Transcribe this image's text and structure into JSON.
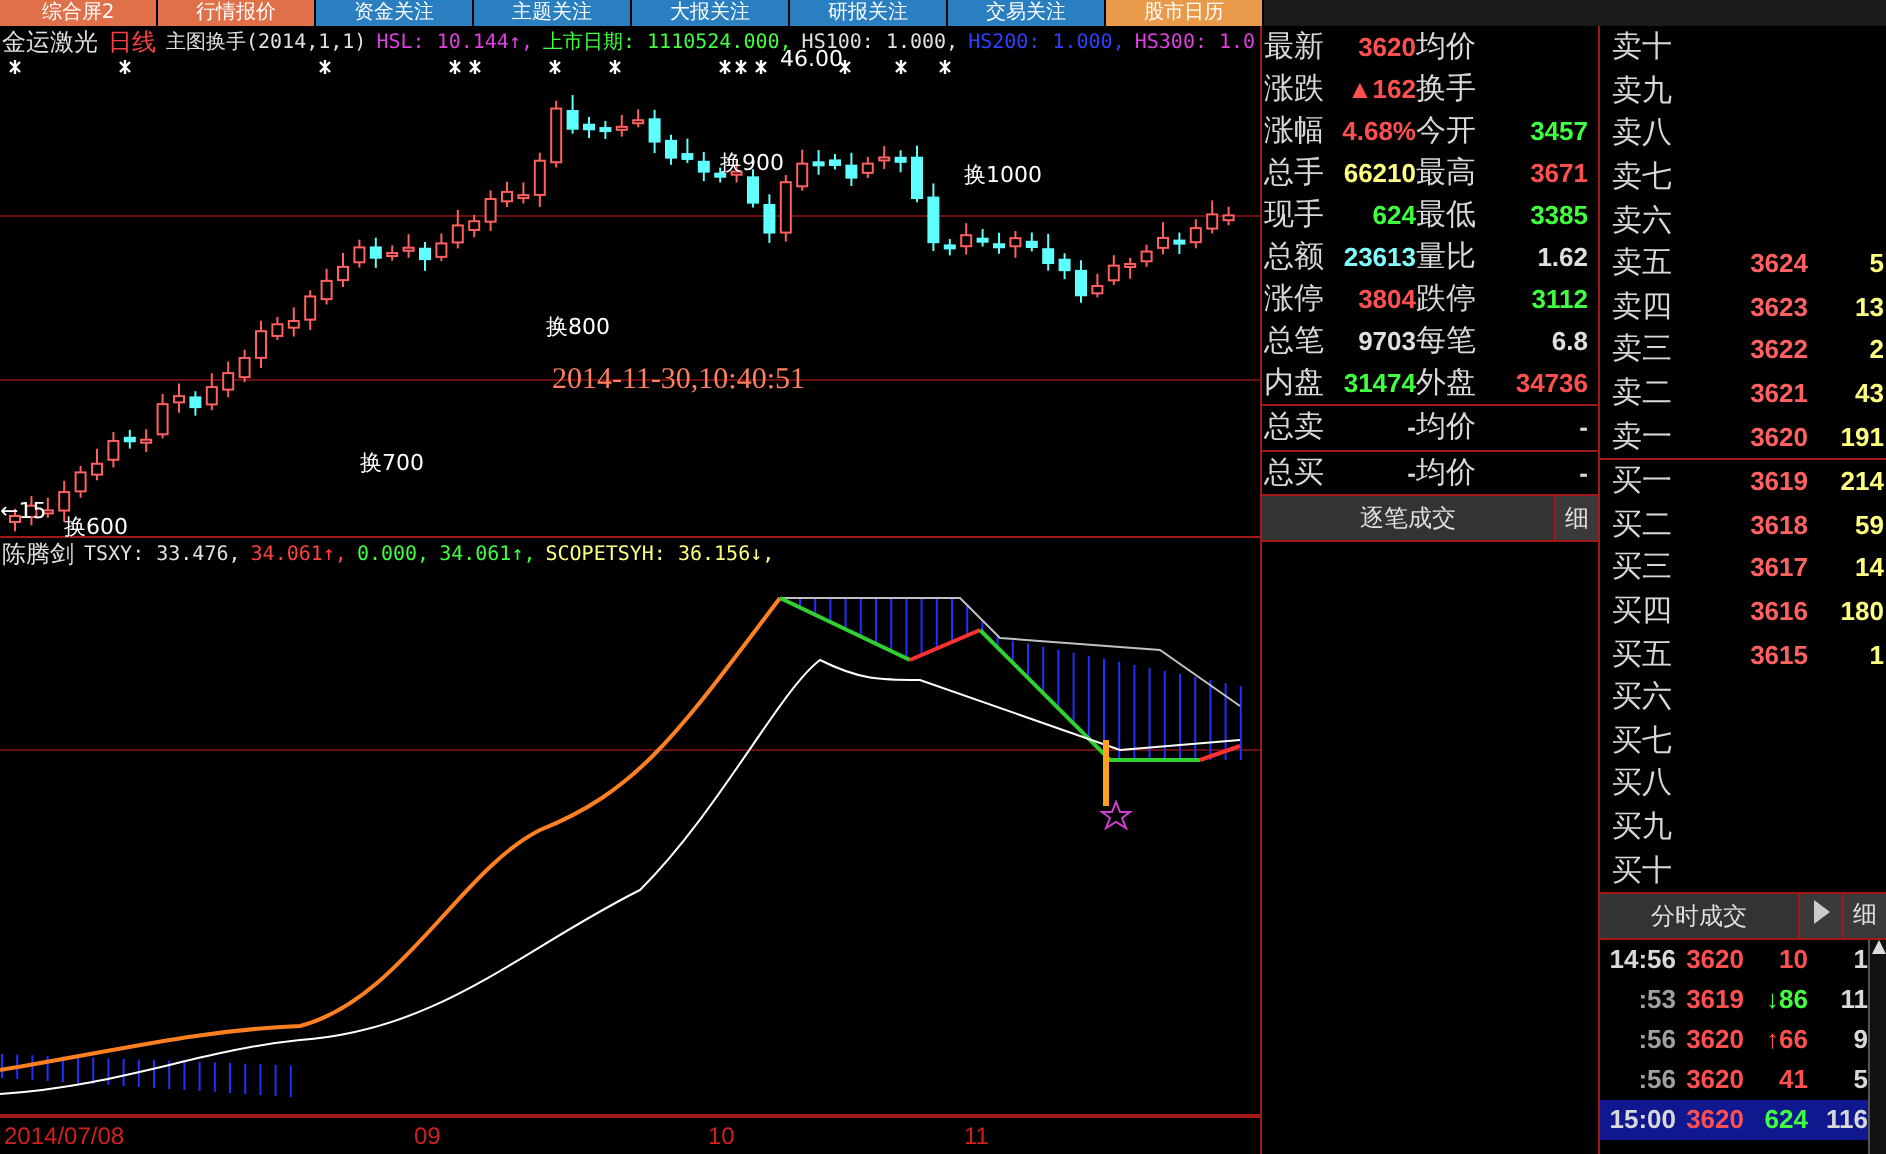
{
  "tabs": [
    {
      "label": "综合屏2",
      "color": "#e0704a"
    },
    {
      "label": "行情报价",
      "color": "#e0704a"
    },
    {
      "label": "资金关注",
      "color": "#2a7fc0"
    },
    {
      "label": "主题关注",
      "color": "#2a7fc0"
    },
    {
      "label": "大报关注",
      "color": "#2a7fc0"
    },
    {
      "label": "研报关注",
      "color": "#2a7fc0"
    },
    {
      "label": "交易关注",
      "color": "#2a7fc0"
    },
    {
      "label": "股市日历",
      "color": "#e89a4a"
    }
  ],
  "main_chart": {
    "stock": "金运激光",
    "period": "日线",
    "formula": "主图换手(2014,1,1)",
    "readouts": [
      {
        "text": "HSL: 10.144↑,",
        "color": "#e040e0"
      },
      {
        "text": "上市日期: 1110524.000,",
        "color": "#40ff40"
      },
      {
        "text": "HS100: 1.000,",
        "color": "#e0e0e0"
      },
      {
        "text": "HS200: 1.000,",
        "color": "#3040ff"
      },
      {
        "text": "HS300: 1.0",
        "color": "#e040e0"
      }
    ],
    "annotations": [
      "换600",
      "←15",
      "换700",
      "换800",
      "换900",
      "换1000",
      "46.00"
    ],
    "timestamp": "2014-11-30,10:40:51"
  },
  "indicator": {
    "name": "陈腾剑",
    "readouts": [
      {
        "text": "TSXY: 33.476,",
        "color": "#e0e0e0"
      },
      {
        "text": "34.061↑,",
        "color": "#ff4040"
      },
      {
        "text": "0.000,",
        "color": "#40ff40"
      },
      {
        "text": "34.061↑,",
        "color": "#40ff40"
      },
      {
        "text": "SCOPETSYH: 36.156↓,",
        "color": "#ffff80"
      }
    ]
  },
  "date_axis": [
    "2014/07/08",
    "09",
    "10",
    "11"
  ],
  "quote": [
    {
      "label": "最新",
      "value": "3620",
      "color": "#ff5050"
    },
    {
      "label": "均价"
    },
    {
      "label": "涨跌",
      "value": "▲162",
      "color": "#ff5050"
    },
    {
      "label": "换手"
    },
    {
      "label": "涨幅",
      "value": "4.68%",
      "color": "#ff5050"
    },
    {
      "label": "今开",
      "value": "3457",
      "color": "#40ff40"
    },
    {
      "label": "总手",
      "value": "66210",
      "color": "#ffff80"
    },
    {
      "label": "最高",
      "value": "3671",
      "color": "#ff5050"
    },
    {
      "label": "现手",
      "value": "624",
      "color": "#40ff40"
    },
    {
      "label": "最低",
      "value": "3385",
      "color": "#40ff40"
    },
    {
      "label": "总额",
      "value": "23613",
      "color": "#80ffff"
    },
    {
      "label": "量比",
      "value": "1.62",
      "color": "#e0e0e0"
    },
    {
      "label": "涨停",
      "value": "3804",
      "color": "#ff5050"
    },
    {
      "label": "跌停",
      "value": "3112",
      "color": "#40ff40"
    },
    {
      "label": "总笔",
      "value": "9703",
      "color": "#e0e0e0"
    },
    {
      "label": "每笔",
      "value": "6.8",
      "color": "#e0e0e0"
    },
    {
      "label": "内盘",
      "value": "31474",
      "color": "#40ff40"
    },
    {
      "label": "外盘",
      "value": "34736",
      "color": "#ff5050"
    }
  ],
  "totals": [
    {
      "label": "总卖",
      "value": "-",
      "label2": "均价",
      "value2": "-"
    },
    {
      "label": "总买",
      "value": "-",
      "label2": "均价",
      "value2": "-"
    }
  ],
  "trades_header": {
    "title": "逐笔成交",
    "button": "细"
  },
  "asks": [
    {
      "label": "卖十"
    },
    {
      "label": "卖九"
    },
    {
      "label": "卖八"
    },
    {
      "label": "卖七"
    },
    {
      "label": "卖六"
    },
    {
      "label": "卖五",
      "price": "3624",
      "volume": "5"
    },
    {
      "label": "卖四",
      "price": "3623",
      "volume": "13"
    },
    {
      "label": "卖三",
      "price": "3622",
      "volume": "2"
    },
    {
      "label": "卖二",
      "price": "3621",
      "volume": "43"
    },
    {
      "label": "卖一",
      "price": "3620",
      "volume": "191"
    }
  ],
  "bids": [
    {
      "label": "买一",
      "price": "3619",
      "volume": "214"
    },
    {
      "label": "买二",
      "price": "3618",
      "volume": "59"
    },
    {
      "label": "买三",
      "price": "3617",
      "volume": "14"
    },
    {
      "label": "买四",
      "price": "3616",
      "volume": "180"
    },
    {
      "label": "买五",
      "price": "3615",
      "volume": "1"
    },
    {
      "label": "买六"
    },
    {
      "label": "买七"
    },
    {
      "label": "买八"
    },
    {
      "label": "买九"
    },
    {
      "label": "买十"
    }
  ],
  "ticks_header": {
    "title": "分时成交",
    "button": "细"
  },
  "ticks": [
    {
      "time": "14:56",
      "price": "3620",
      "volume": "10",
      "count": "1",
      "selected": false
    },
    {
      "time": ":53",
      "price": "3619",
      "arrow": "↓",
      "volume": "86",
      "count": "11",
      "selected": false
    },
    {
      "time": ":56",
      "price": "3620",
      "arrow": "↑",
      "volume": "66",
      "count": "9",
      "selected": false
    },
    {
      "time": ":56",
      "price": "3620",
      "volume": "41",
      "count": "5",
      "selected": false
    },
    {
      "time": "15:00",
      "price": "3620",
      "volume": "624",
      "count": "116",
      "selected": true
    }
  ]
}
